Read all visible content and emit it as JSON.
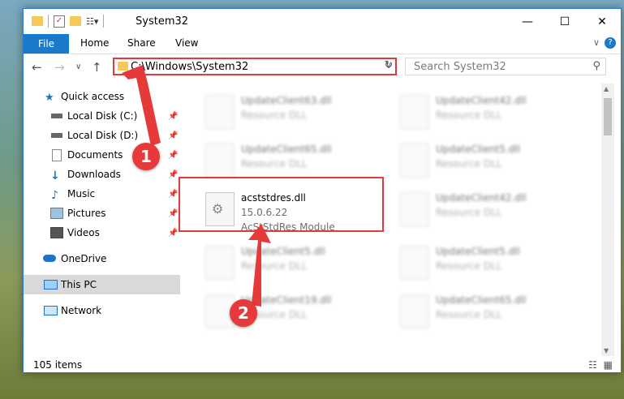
{
  "window": {
    "title": "System32"
  },
  "ribbon": {
    "file": "File",
    "home": "Home",
    "share": "Share",
    "view": "View"
  },
  "address": {
    "path": "C:\\Windows\\System32"
  },
  "search": {
    "placeholder": "Search System32"
  },
  "nav": {
    "items": [
      {
        "label": "Quick access",
        "icon": "star-icon"
      },
      {
        "label": "Local Disk (C:)",
        "icon": "drive-icon",
        "pinned": true
      },
      {
        "label": "Local Disk (D:)",
        "icon": "drive-icon",
        "pinned": true
      },
      {
        "label": "Documents",
        "icon": "documents-icon",
        "pinned": true
      },
      {
        "label": "Downloads",
        "icon": "download-icon",
        "pinned": true
      },
      {
        "label": "Music",
        "icon": "music-icon",
        "pinned": true
      },
      {
        "label": "Pictures",
        "icon": "pictures-icon",
        "pinned": true
      },
      {
        "label": "Videos",
        "icon": "videos-icon",
        "pinned": true
      },
      {
        "label": "OneDrive",
        "icon": "cloud-icon"
      },
      {
        "label": "This PC",
        "icon": "computer-icon",
        "selected": true
      },
      {
        "label": "Network",
        "icon": "network-icon"
      }
    ]
  },
  "files": [
    {
      "name": "UpdateClient63.dll",
      "type": "Resource DLL"
    },
    {
      "name": "UpdateClient42.dll",
      "type": "Resource DLL"
    },
    {
      "name": "UpdateClient65.dll",
      "type": "Resource DLL"
    },
    {
      "name": "UpdateClient5.dll",
      "type": "Resource DLL"
    },
    {
      "name": "acststdres.dll",
      "version": "15.0.6.22",
      "desc": "AcStStdRes Module"
    },
    {
      "name": "UpdateClient42.dll",
      "type": "Resource DLL"
    },
    {
      "name": "UpdateClient5.dll",
      "type": "Resource DLL"
    },
    {
      "name": "UpdateClient5.dll",
      "type": "Resource DLL"
    },
    {
      "name": "UpdateClient19.dll",
      "type": "Resource DLL"
    },
    {
      "name": "UpdateClient65.dll",
      "type": "Resource DLL"
    }
  ],
  "status": {
    "count": "105 items"
  },
  "annotations": {
    "step1": "1",
    "step2": "2"
  },
  "colors": {
    "accent": "#1979ca",
    "highlight": "#e0393e"
  }
}
